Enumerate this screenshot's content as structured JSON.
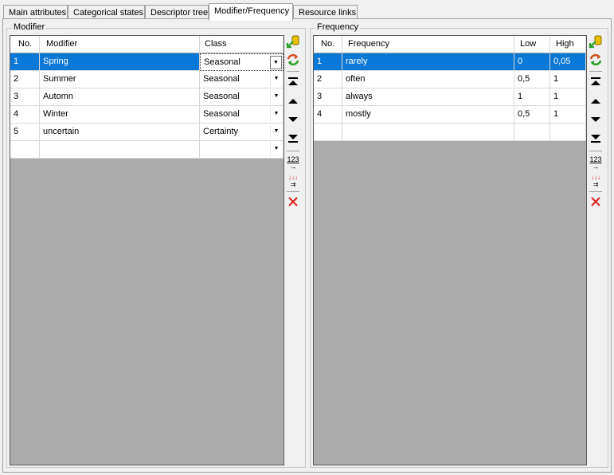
{
  "tabs": [
    {
      "label": "Main attributes"
    },
    {
      "label": "Categorical states"
    },
    {
      "label": "Descriptor tree"
    },
    {
      "label": "Modifier/Frequency"
    },
    {
      "label": "Resource links"
    }
  ],
  "modifier": {
    "title": "Modifier",
    "headers": {
      "no": "No.",
      "modifier": "Modifier",
      "class": "Class"
    },
    "rows": [
      {
        "no": "1",
        "modifier": "Spring",
        "class": "Seasonal"
      },
      {
        "no": "2",
        "modifier": "Summer",
        "class": "Seasonal"
      },
      {
        "no": "3",
        "modifier": "Automn",
        "class": "Seasonal"
      },
      {
        "no": "4",
        "modifier": "Winter",
        "class": "Seasonal"
      },
      {
        "no": "5",
        "modifier": "uncertain",
        "class": "Certainty"
      }
    ]
  },
  "frequency": {
    "title": "Frequency",
    "headers": {
      "no": "No.",
      "frequency": "Frequency",
      "low": "Low",
      "high": "High"
    },
    "rows": [
      {
        "no": "1",
        "frequency": "rarely",
        "low": "0",
        "high": "0,05"
      },
      {
        "no": "2",
        "frequency": "often",
        "low": "0,5",
        "high": "1"
      },
      {
        "no": "3",
        "frequency": "always",
        "low": "1",
        "high": "1"
      },
      {
        "no": "4",
        "frequency": "mostly",
        "low": "0,5",
        "high": "1"
      }
    ]
  },
  "toolbar": {
    "icons": [
      "add-icon",
      "refresh-icon",
      "move-top-icon",
      "move-up-icon",
      "move-down-icon",
      "move-bottom-icon",
      "renumber-icon",
      "sort-icon",
      "delete-icon"
    ],
    "renumber_glyph": "123",
    "sort_glyph": "↓↓↓"
  },
  "colors": {
    "selection": "#0a78d7",
    "grid_empty": "#ababab",
    "delete": "#e02020"
  }
}
